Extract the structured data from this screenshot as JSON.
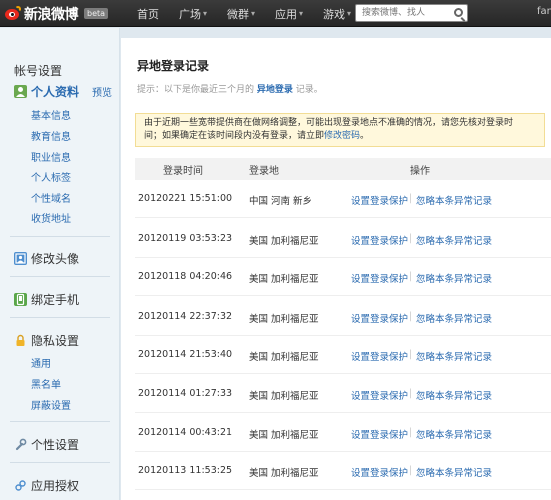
{
  "brand": {
    "name": "新浪微博",
    "badge": "beta"
  },
  "nav": {
    "items": [
      {
        "label": "首页",
        "caret": ""
      },
      {
        "label": "广场",
        "caret": "▾"
      },
      {
        "label": "微群",
        "caret": "▾"
      },
      {
        "label": "应用",
        "caret": "▾"
      },
      {
        "label": "游戏",
        "caret": "▾"
      }
    ],
    "search_placeholder": "搜索微博、找人",
    "user": "fanc"
  },
  "sidebar": {
    "title": "帐号设置",
    "sections": [
      {
        "label": "个人资料",
        "extra": "预览",
        "icon": "profile-icon",
        "subs": [
          "基本信息",
          "教育信息",
          "职业信息",
          "个人标签",
          "个性域名",
          "收货地址"
        ]
      },
      {
        "label": "修改头像",
        "icon": "avatar-icon",
        "subs": []
      },
      {
        "label": "绑定手机",
        "icon": "phone-icon",
        "subs": []
      },
      {
        "label": "隐私设置",
        "icon": "lock-icon",
        "subs": [
          "通用",
          "黑名单",
          "屏蔽设置"
        ]
      },
      {
        "label": "个性设置",
        "icon": "wrench-icon",
        "subs": []
      },
      {
        "label": "应用授权",
        "icon": "link-icon",
        "subs": []
      }
    ]
  },
  "main": {
    "title": "异地登录记录",
    "tip_prefix": "提示：以下是你最近三个月的",
    "tip_link": "异地登录",
    "tip_suffix": "记录。",
    "notice_line1": "由于近期一些宽带提供商在做网络调整，可能出现登录地点不准确的情况，请您先核对登录时",
    "notice_line2_prefix": "间；如果确定在该时间段内没有登录，请立即",
    "notice_link": "修改密码",
    "notice_end": "。",
    "headers": [
      "登录时间",
      "登录地",
      "操作"
    ],
    "action_protect": "设置登录保护",
    "action_ignore": "忽略本条异常记录",
    "rows": [
      {
        "time": "20120221 15:51:00",
        "location": "中国 河南 新乡"
      },
      {
        "time": "20120119 03:53:23",
        "location": "美国 加利福尼亚"
      },
      {
        "time": "20120118 04:20:46",
        "location": "美国 加利福尼亚"
      },
      {
        "time": "20120114 22:37:32",
        "location": "美国 加利福尼亚"
      },
      {
        "time": "20120114 21:53:40",
        "location": "美国 加利福尼亚"
      },
      {
        "time": "20120114 01:27:33",
        "location": "美国 加利福尼亚"
      },
      {
        "time": "20120114 00:43:21",
        "location": "美国 加利福尼亚"
      },
      {
        "time": "20120113 11:53:25",
        "location": "美国 加利福尼亚"
      }
    ]
  },
  "colors": {
    "link": "#2b6bb0",
    "topbar": "#2e2e2e",
    "notice_bg": "#fff8dc"
  }
}
